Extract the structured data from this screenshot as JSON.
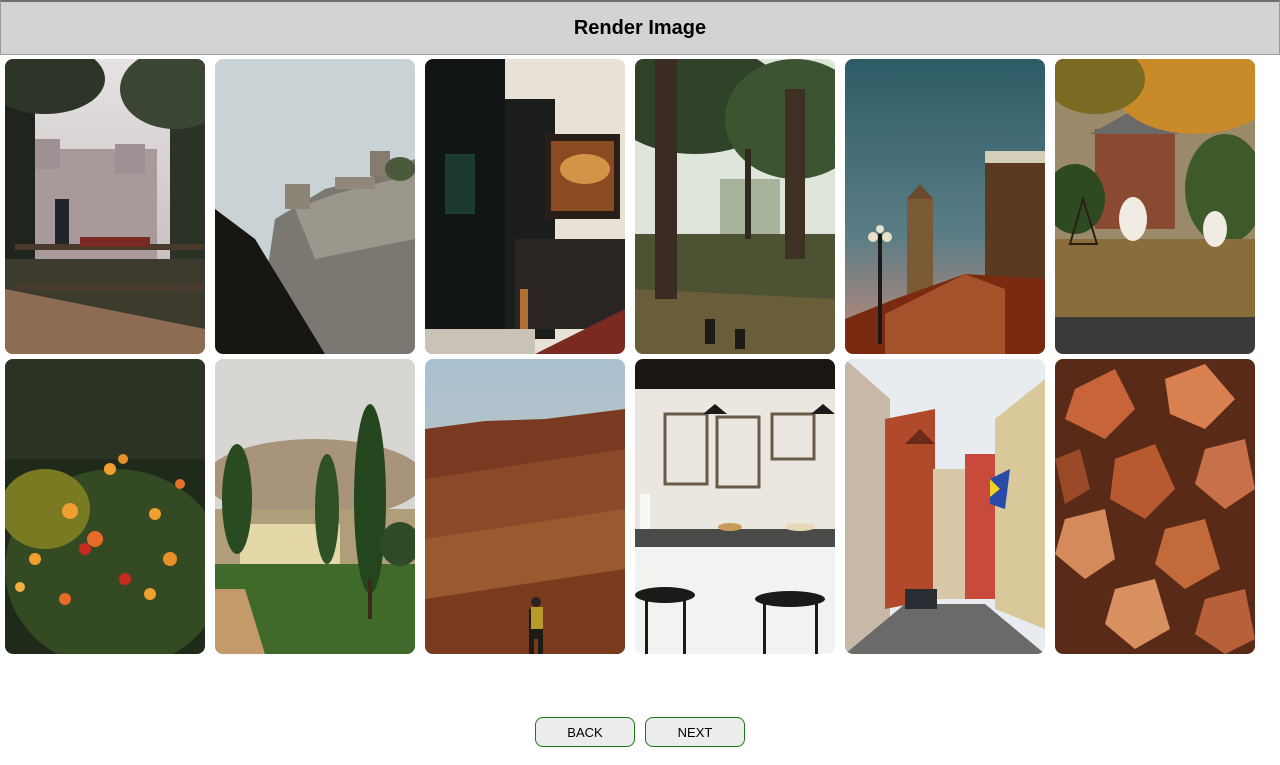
{
  "header": {
    "title": "Render Image"
  },
  "nav": {
    "back_label": "BACK",
    "next_label": "NEXT"
  }
}
